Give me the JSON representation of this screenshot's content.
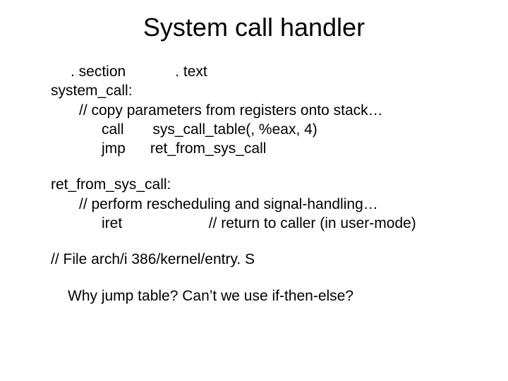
{
  "title": "System call handler",
  "code": {
    "block1": [
      ". section            . text",
      "system_call:",
      "// copy parameters from registers onto stack…",
      "call       sys_call_table(, %eax, 4)",
      "jmp      ret_from_sys_call"
    ],
    "block2": [
      "ret_from_sys_call:",
      "// perform rescheduling and signal-handling…",
      "iret                     // return to caller (in user-mode)"
    ],
    "file_note": "// File arch/i 386/kernel/entry. S",
    "question": "Why jump table?  Can’t we use if-then-else?"
  }
}
